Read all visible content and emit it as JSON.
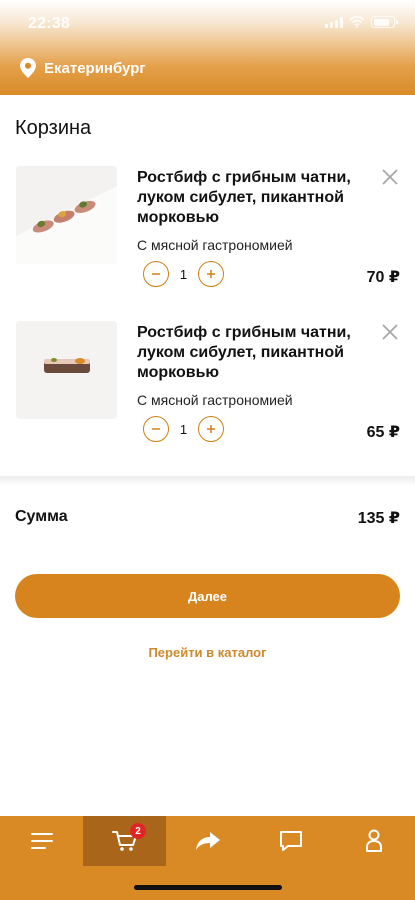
{
  "status_bar": {
    "time": "22:38"
  },
  "header": {
    "location": "Екатеринбург"
  },
  "cart": {
    "title": "Корзина",
    "items": [
      {
        "name": "Ростбиф с грибным чатни, луком сибулет, пикантной морковью",
        "category": "С мясной гастрономией",
        "quantity": "1",
        "price": "70 ₽",
        "image": "three-canape-dish"
      },
      {
        "name": "Ростбиф с грибным чатни, луком сибулет, пикантной морковью",
        "category": "С мясной гастрономией",
        "quantity": "1",
        "price": "65 ₽",
        "image": "single-roll-dish"
      }
    ],
    "sum_label": "Сумма",
    "sum_value": "135 ₽",
    "next_button": "Далее",
    "catalog_link": "Перейти в каталог"
  },
  "tabbar": {
    "cart_badge": "2",
    "tabs": [
      "menu-icon",
      "cart-icon",
      "share-icon",
      "chat-icon",
      "profile-icon"
    ],
    "active_index": 1
  },
  "colors": {
    "accent": "#d8841e",
    "active_tab": "#a9661a",
    "badge": "#e12525",
    "link": "#cd8a2d"
  }
}
